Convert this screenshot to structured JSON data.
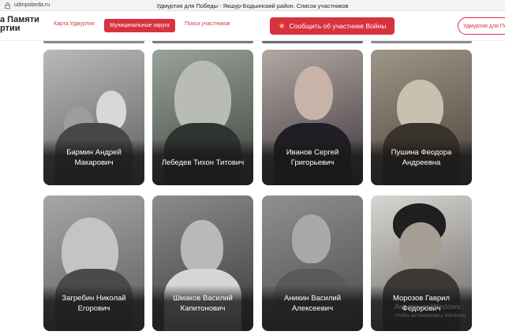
{
  "browser": {
    "url": "udmpobeda.ru",
    "tab_title": "Удмуртия для Победы - Якшур-Бодьинский район. Список участников"
  },
  "header": {
    "logo_line1": "а Памяти",
    "logo_line2": "ртии",
    "nav": [
      "Карта Удмуртии",
      "Муниципальные округа",
      "Поиск участников"
    ],
    "report_button": "Сообщить об участнике Войны",
    "region_button": "Удмуртия для Побед"
  },
  "participants": [
    {
      "name": "Бармин Андрей Макарович"
    },
    {
      "name": "Лебедев Тихон Титович"
    },
    {
      "name": "Иванов Сергей Григорьевич"
    },
    {
      "name": "Пушина Феодора Андреевна"
    },
    {
      "name": "Загребин Николай Егорович"
    },
    {
      "name": "Шмаков Василий Капитонович"
    },
    {
      "name": "Аникин Василий Алексеевич"
    },
    {
      "name": "Морозов Гаврил Федорович"
    }
  ],
  "watermark": {
    "line1": "Активация Windows",
    "line2": "Чтобы активировать Windows"
  },
  "colors": {
    "accent": "#d8323f",
    "star": "#f7c84b"
  }
}
